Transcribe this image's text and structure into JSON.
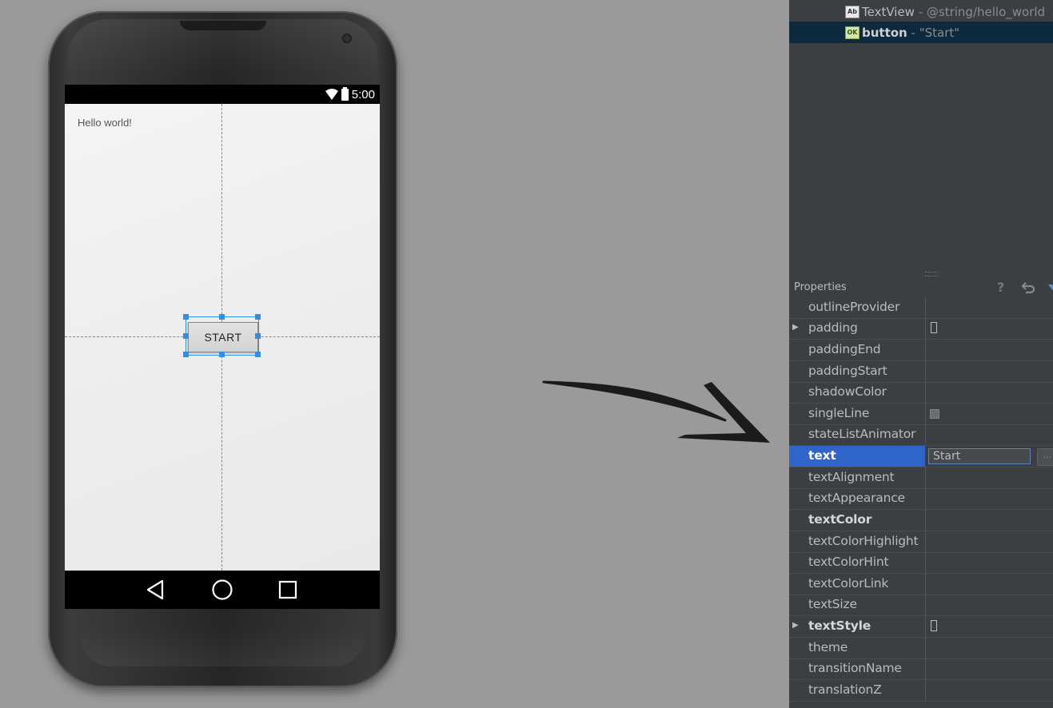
{
  "phone": {
    "status_time": "5:00",
    "hello_text": "Hello world!",
    "button_label": "START"
  },
  "component_tree": {
    "items": [
      {
        "icon": "Ab",
        "name": "TextView",
        "separator": " - ",
        "value": "@string/hello_world"
      },
      {
        "icon": "OK",
        "name": "button",
        "separator": " - ",
        "value": "\"Start\""
      }
    ]
  },
  "properties": {
    "title": "Properties",
    "help": "?",
    "rows": [
      {
        "name": "outlineProvider"
      },
      {
        "name": "padding"
      },
      {
        "name": "paddingEnd"
      },
      {
        "name": "paddingStart"
      },
      {
        "name": "shadowColor"
      },
      {
        "name": "singleLine"
      },
      {
        "name": "stateListAnimator"
      },
      {
        "name": "text",
        "value": "Start",
        "ellipsis": "..."
      },
      {
        "name": "textAlignment"
      },
      {
        "name": "textAppearance"
      },
      {
        "name": "textColor"
      },
      {
        "name": "textColorHighlight"
      },
      {
        "name": "textColorHint"
      },
      {
        "name": "textColorLink"
      },
      {
        "name": "textSize"
      },
      {
        "name": "textStyle"
      },
      {
        "name": "theme"
      },
      {
        "name": "transitionName"
      },
      {
        "name": "translationZ"
      }
    ]
  },
  "colors": {
    "selection_blue": "#2f65ca",
    "guide_green": "#3dbb3d",
    "ide_background": "#3c3f41"
  }
}
